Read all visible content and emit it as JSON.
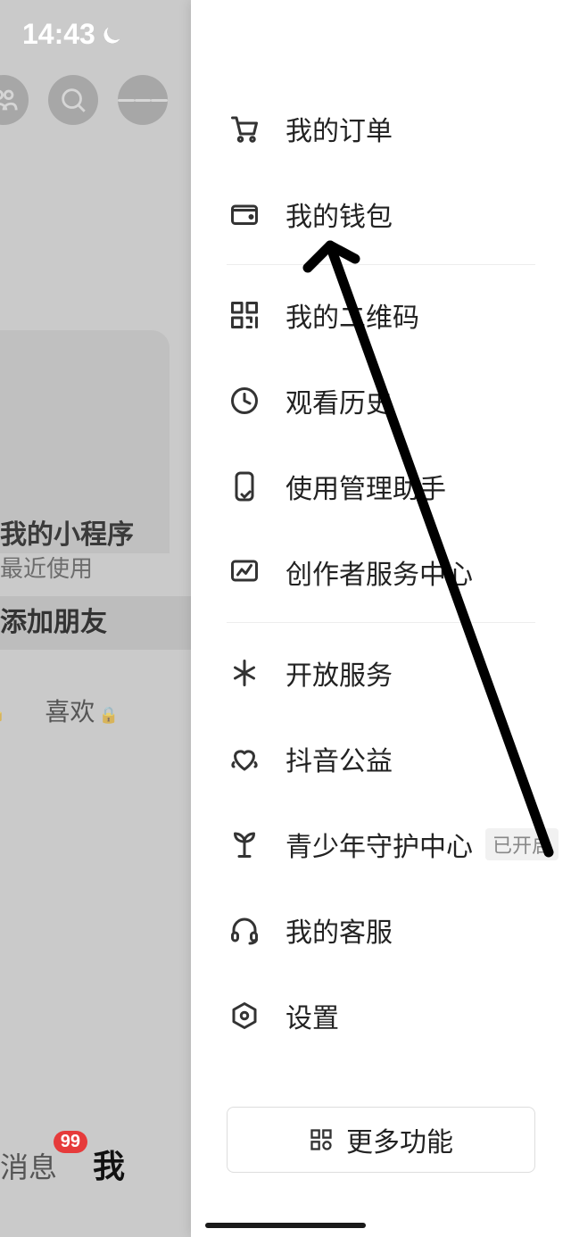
{
  "status": {
    "time": "14:43"
  },
  "bg": {
    "miniprogram_title": "我的小程序",
    "miniprogram_sub": "最近使用",
    "add_friend": "添加朋友",
    "tab_like": "喜欢",
    "nav_msg": "消息",
    "nav_msg_badge": "99",
    "nav_me": "我"
  },
  "menu": {
    "orders": "我的订单",
    "wallet": "我的钱包",
    "qrcode": "我的二维码",
    "history": "观看历史",
    "usage": "使用管理助手",
    "creator": "创作者服务中心",
    "open": "开放服务",
    "charity": "抖音公益",
    "youth": "青少年守护中心",
    "youth_tag": "已开启",
    "support": "我的客服",
    "settings": "设置",
    "more": "更多功能"
  }
}
